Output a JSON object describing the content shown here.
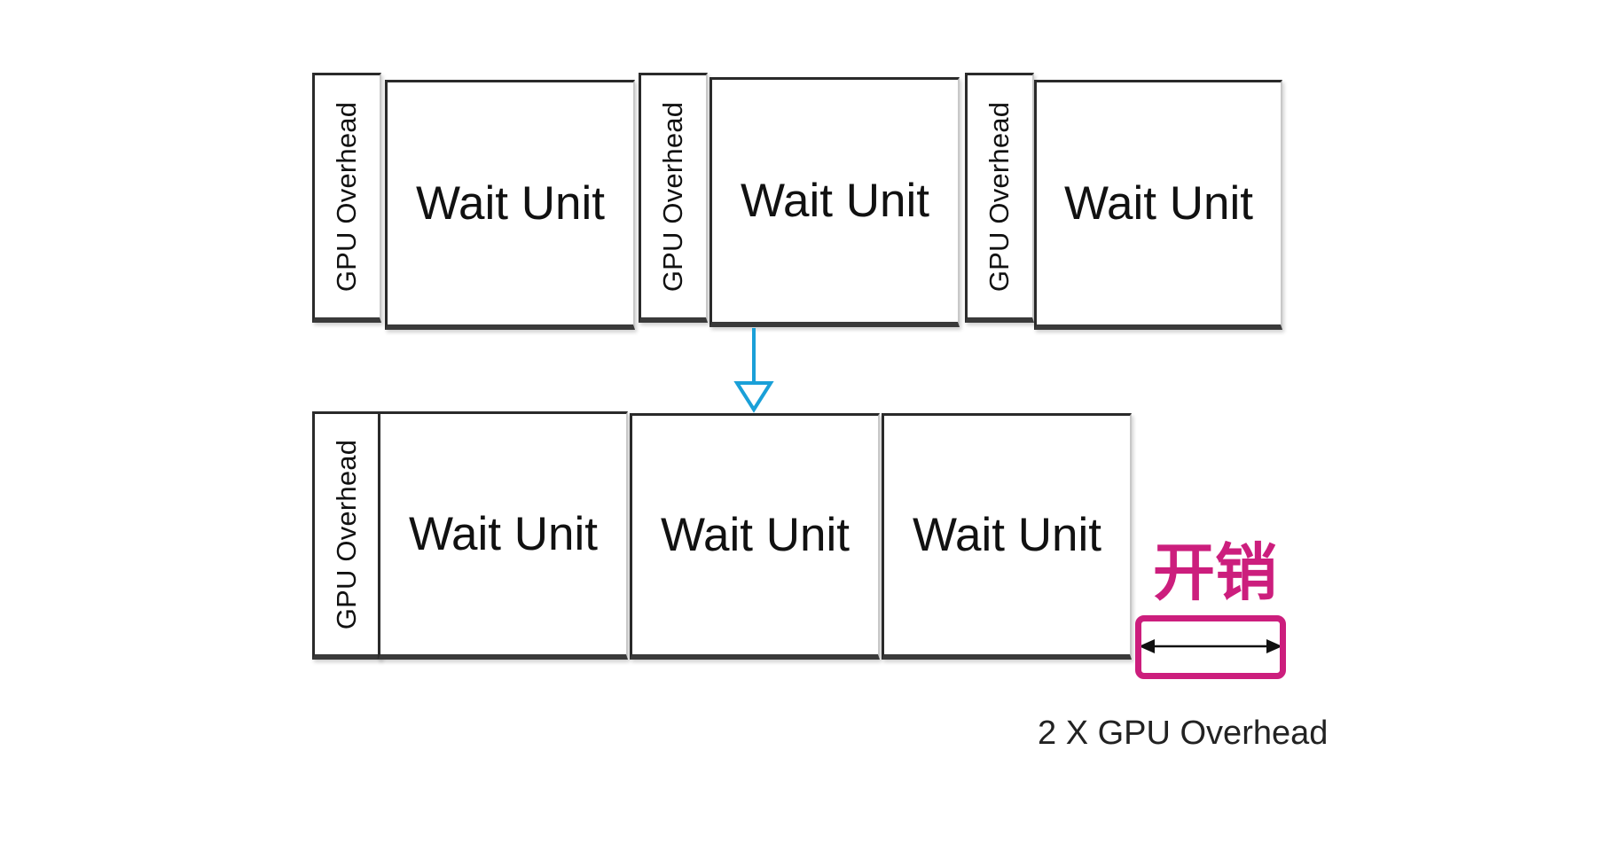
{
  "top_row": {
    "overhead_labels": [
      "GPU Overhead",
      "GPU Overhead",
      "GPU Overhead"
    ],
    "unit_labels": [
      "Wait Unit",
      "Wait Unit",
      "Wait Unit"
    ]
  },
  "bottom_row": {
    "overhead_label": "GPU Overhead",
    "unit_labels": [
      "Wait Unit",
      "Wait Unit",
      "Wait Unit"
    ]
  },
  "cost": {
    "label": "开销",
    "caption": "2 X GPU Overhead"
  },
  "colors": {
    "arrow": "#1aa0d8",
    "accent": "#cc1e7d",
    "border": "#2a2a2a"
  }
}
